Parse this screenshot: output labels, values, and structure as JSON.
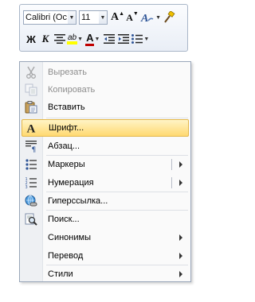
{
  "mini_toolbar": {
    "font_name": "Calibri (Oc",
    "font_size": "11",
    "grow_font_label": "A",
    "shrink_font_label": "A",
    "bold_label": "Ж",
    "italic_label": "К",
    "highlight_label": "ab",
    "font_color_label": "A",
    "highlight_color": "#ffff00",
    "font_color_value": "#c00000"
  },
  "context_menu": {
    "items": [
      {
        "label": "Вырезать",
        "icon": "scissors-icon",
        "enabled": false
      },
      {
        "label": "Копировать",
        "icon": "copy-icon",
        "enabled": false
      },
      {
        "label": "Вставить",
        "icon": "paste-icon",
        "enabled": true
      },
      {
        "label": "Шрифт...",
        "icon": "font-icon",
        "enabled": true,
        "highlighted": true
      },
      {
        "label": "Абзац...",
        "icon": "paragraph-icon",
        "enabled": true
      },
      {
        "label": "Маркеры",
        "icon": "bullets-icon",
        "enabled": true,
        "submenu": true,
        "split": true
      },
      {
        "label": "Нумерация",
        "icon": "numbering-icon",
        "enabled": true,
        "submenu": true,
        "split": true
      },
      {
        "label": "Гиперссылка...",
        "icon": "hyperlink-icon",
        "enabled": true
      },
      {
        "label": "Поиск...",
        "icon": "research-icon",
        "enabled": true
      },
      {
        "label": "Синонимы",
        "icon": "",
        "enabled": true,
        "submenu": true
      },
      {
        "label": "Перевод",
        "icon": "",
        "enabled": true,
        "submenu": true
      },
      {
        "label": "Стили",
        "icon": "",
        "enabled": true,
        "submenu": true
      }
    ]
  },
  "colors": {
    "highlight_bg_top": "#fff4c6",
    "highlight_bg_bottom": "#ffd971",
    "highlight_border": "#e3b74b",
    "disabled_text": "#8d8d8d"
  }
}
